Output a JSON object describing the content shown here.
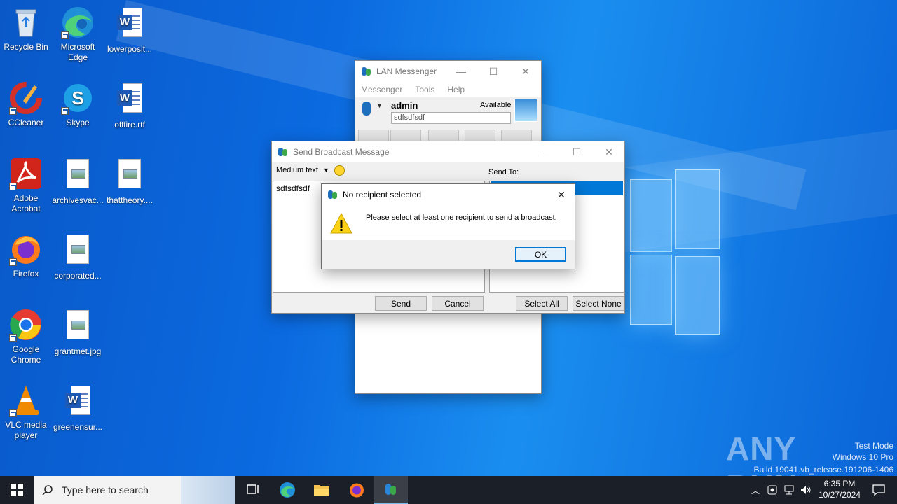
{
  "desktop": {
    "icons": [
      {
        "label": "Recycle Bin"
      },
      {
        "label": "Microsoft Edge"
      },
      {
        "label": "lowerposit..."
      },
      {
        "label": "CCleaner"
      },
      {
        "label": "Skype"
      },
      {
        "label": "offfire.rtf"
      },
      {
        "label": "Adobe Acrobat"
      },
      {
        "label": "archivesvac..."
      },
      {
        "label": "thattheory...."
      },
      {
        "label": "Firefox"
      },
      {
        "label": "corporated..."
      },
      {
        "label": "Google Chrome"
      },
      {
        "label": "grantmet.jpg"
      },
      {
        "label": "VLC media player"
      },
      {
        "label": "greenensur..."
      }
    ],
    "watermark": {
      "line1": "Test Mode",
      "line2": "Windows 10 Pro",
      "line3": "Build 19041.vb_release.191206-1406",
      "brand": "ANY RUN"
    }
  },
  "lan_messenger": {
    "title": "LAN Messenger",
    "menu": [
      "Messenger",
      "Tools",
      "Help"
    ],
    "username": "admin",
    "status": "Available",
    "status_note": "sdfsdfsdf"
  },
  "broadcast": {
    "title": "Send Broadcast Message",
    "font_size": "Medium text",
    "message": "sdfsdfsdf",
    "send_to_label": "Send To:",
    "send_label": "Send",
    "cancel_label": "Cancel",
    "select_all_label": "Select All",
    "select_none_label": "Select None"
  },
  "alert": {
    "title": "No recipient selected",
    "message": "Please select at least one recipient to send a broadcast.",
    "ok_label": "OK"
  },
  "taskbar": {
    "search_placeholder": "Type here to search",
    "time": "6:35 PM",
    "date": "10/27/2024"
  }
}
